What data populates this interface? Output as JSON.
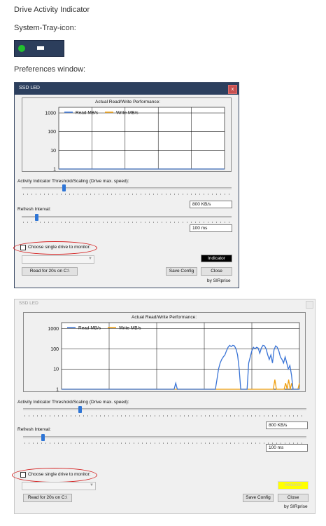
{
  "page": {
    "heading_app": "Drive Activity Indicator",
    "heading_tray": "System-Tray-icon:",
    "heading_prefs": "Preferences window:"
  },
  "colors": {
    "read": "#3a74d6",
    "write": "#f0a010",
    "indicator_on": "#000000",
    "indicator_off": "#ffff00",
    "tray_led": "#22c02e",
    "annotation_oval": "#d42020"
  },
  "windows": [
    {
      "title": "SSD LED",
      "close_label": "x",
      "chart_title": "Actual Read/Write Performance:",
      "threshold_label": "Activity Indicator Threshold/Scaling (Drive max. speed):",
      "threshold_value": "800 KB/s",
      "threshold_slider_fraction": 0.2,
      "refresh_label": "Refresh Interval:",
      "refresh_value": "100 ms",
      "refresh_slider_fraction": 0.07,
      "checkbox_label": "Choose single drive to monitor:",
      "indicator_label": "Indicator",
      "read_button": "Read for 20s on C:\\",
      "save_button": "Save Config",
      "close_button": "Close",
      "author": "by SIRprise"
    },
    {
      "title": "SSD LED",
      "chart_title": "Actual Read/Write Performance:",
      "threshold_label": "Activity Indicator Threshold/Scaling (Drive max. speed):",
      "threshold_value": "800 KB/s",
      "threshold_slider_fraction": 0.2,
      "refresh_label": "Refresh Interval:",
      "refresh_value": "100 ms",
      "refresh_slider_fraction": 0.07,
      "checkbox_label": "Choose single drive to monitor:",
      "indicator_label": "Indicator",
      "read_button": "Read for 20s on C:\\",
      "save_button": "Save Config",
      "close_button": "Close",
      "author": "by SIRprise"
    }
  ],
  "chart_data": [
    {
      "type": "line",
      "title": "Actual Read/Write Performance:",
      "y_scale": "log",
      "ylim": [
        1,
        2000
      ],
      "yticks": [
        "1",
        "10",
        "100",
        "1000"
      ],
      "grid": true,
      "legend_position": "top-left",
      "series": [
        {
          "name": "Read MB/s",
          "values": [
            1,
            1,
            1,
            1,
            1,
            1,
            1,
            1,
            1,
            1,
            1,
            1,
            1,
            1,
            1,
            1,
            1,
            1,
            1,
            1,
            1,
            1,
            1,
            1,
            1,
            1,
            1,
            1,
            1,
            1,
            1,
            1,
            1,
            1,
            1,
            1,
            1,
            1,
            1,
            1
          ]
        },
        {
          "name": "Write MB/s",
          "values": [
            1,
            1,
            1,
            1,
            1,
            1,
            1,
            1,
            1,
            1,
            1,
            1,
            1,
            1,
            1,
            1,
            1,
            1,
            1,
            1,
            1,
            1,
            1,
            1,
            1,
            1,
            1,
            1,
            1,
            1,
            1,
            1,
            1,
            1,
            1,
            1,
            1,
            1,
            1,
            1
          ]
        }
      ]
    },
    {
      "type": "line",
      "title": "Actual Read/Write Performance:",
      "y_scale": "log",
      "ylim": [
        1,
        2000
      ],
      "yticks": [
        "1",
        "10",
        "100",
        "1000"
      ],
      "grid": true,
      "legend_position": "top-left",
      "series": [
        {
          "name": "Read MB/s",
          "values": [
            1,
            1,
            1,
            1,
            1,
            1,
            1,
            1,
            1,
            1,
            1,
            1,
            1,
            1,
            1,
            1,
            1,
            1,
            1,
            1,
            1,
            1,
            1,
            1,
            1,
            1,
            1,
            1,
            1,
            1,
            1,
            1,
            1,
            1,
            1,
            1,
            1,
            1,
            1,
            1,
            1,
            1,
            1,
            1,
            1,
            1,
            1,
            1,
            1,
            1,
            1,
            1,
            1,
            1,
            1,
            1,
            1,
            1,
            1,
            1,
            1,
            1,
            1,
            1,
            1,
            1,
            1,
            1,
            1,
            1,
            1,
            1,
            2,
            1,
            1,
            1,
            1,
            1,
            1,
            1,
            1,
            1,
            1,
            1,
            1,
            1,
            1,
            1,
            1,
            1,
            1,
            1,
            1,
            1,
            1,
            1,
            1,
            1,
            3,
            10,
            20,
            30,
            40,
            50,
            80,
            120,
            150,
            130,
            150,
            140,
            100,
            50,
            10,
            1,
            1,
            1,
            1,
            1,
            20,
            40,
            80,
            120,
            100,
            120,
            110,
            60,
            110,
            150,
            140,
            100,
            50,
            30,
            50,
            20,
            90,
            140,
            120,
            80,
            40,
            30,
            20,
            40,
            20,
            10,
            15,
            5,
            1,
            1,
            1,
            1,
            1
          ]
        },
        {
          "name": "Write MB/s",
          "values": [
            1,
            1,
            1,
            1,
            1,
            1,
            1,
            1,
            1,
            1,
            1,
            1,
            1,
            1,
            1,
            1,
            1,
            1,
            1,
            1,
            1,
            1,
            1,
            1,
            1,
            1,
            1,
            1,
            1,
            1,
            1,
            1,
            1,
            1,
            1,
            1,
            1,
            1,
            1,
            1,
            1,
            1,
            1,
            1,
            1,
            1,
            1,
            1,
            1,
            1,
            1,
            1,
            1,
            1,
            1,
            1,
            1,
            1,
            1,
            1,
            1,
            1,
            1,
            1,
            1,
            1,
            1,
            1,
            1,
            1,
            1,
            1,
            1,
            1,
            1,
            1,
            1,
            1,
            1,
            1,
            1,
            1,
            1,
            1,
            1,
            1,
            1,
            1,
            1,
            1,
            1,
            1,
            1,
            1,
            1,
            1,
            1,
            1,
            1,
            1,
            1,
            1,
            1,
            1,
            1,
            1,
            1,
            1,
            1,
            1,
            1,
            1,
            1,
            1,
            1,
            1,
            1,
            1,
            1,
            1,
            1,
            1,
            1,
            1,
            1,
            1,
            1,
            1,
            1,
            1,
            1,
            1,
            1,
            1,
            1,
            1,
            1,
            1,
            1,
            3,
            1,
            1,
            1,
            1,
            1,
            1,
            2,
            1,
            3,
            1,
            2,
            1,
            1,
            1,
            1,
            2
          ]
        }
      ]
    }
  ]
}
